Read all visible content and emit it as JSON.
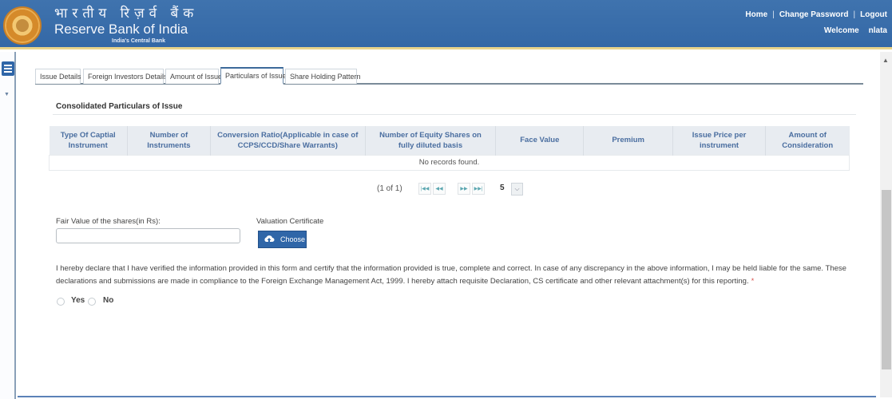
{
  "header": {
    "brand_hindi": "भारतीय रिज़र्व बैंक",
    "brand_english": "Reserve Bank of India",
    "brand_tagline": "India's Central Bank",
    "links": [
      "Home",
      "Change Password",
      "Logout"
    ],
    "separator": "|",
    "welcome_label": "Welcome",
    "username": "nlata"
  },
  "tabs": [
    {
      "label": "Issue Details",
      "active": false
    },
    {
      "label": "Foreign Investors Details",
      "active": false
    },
    {
      "label": "Amount of Issue",
      "active": false
    },
    {
      "label": "Particulars of Issue",
      "active": true
    },
    {
      "label": "Share Holding Pattern",
      "active": false
    }
  ],
  "section": {
    "title": "Consolidated Particulars of Issue"
  },
  "table": {
    "columns": [
      "Type Of Captial Instrument",
      "Number of Instruments",
      "Conversion Ratio(Applicable in case of CCPS/CCD/Share Warrants)",
      "Number of Equity Shares on fully diluted basis",
      "Face Value",
      "Premium",
      "Issue Price per instrument",
      "Amount of Consideration"
    ],
    "rows": [],
    "empty_message": "No records found."
  },
  "pager": {
    "current": "(1 of 1)",
    "first_icon": "first-page-icon",
    "prev_icon": "previous-page-icon",
    "next_icon": "next-page-icon",
    "last_icon": "last-page-icon",
    "rows_per_page": "5"
  },
  "form": {
    "fair_value_label": "Fair Value of the shares(in Rs):",
    "fair_value_value": "",
    "valuation_label": "Valuation Certificate",
    "choose_label": "Choose",
    "declaration": "I hereby declare that I have verified the information provided in this form and certify that the information provided is true, complete and correct. In case of any discrepancy in the above information, I may be held liable for the same. These declarations and submissions are made in compliance to the Foreign Exchange Management Act, 1999. I hereby attach requisite Declaration, CS certificate and other relevant attachment(s) for this reporting.",
    "required_mark": "*",
    "options": [
      "Yes",
      "No"
    ],
    "selected": null
  },
  "colors": {
    "header_blue": "#3468a6",
    "accent_gold": "#e8d38a",
    "primary_button": "#2f66a8",
    "table_header_text": "#4a6ea0",
    "required": "#d9534f"
  }
}
